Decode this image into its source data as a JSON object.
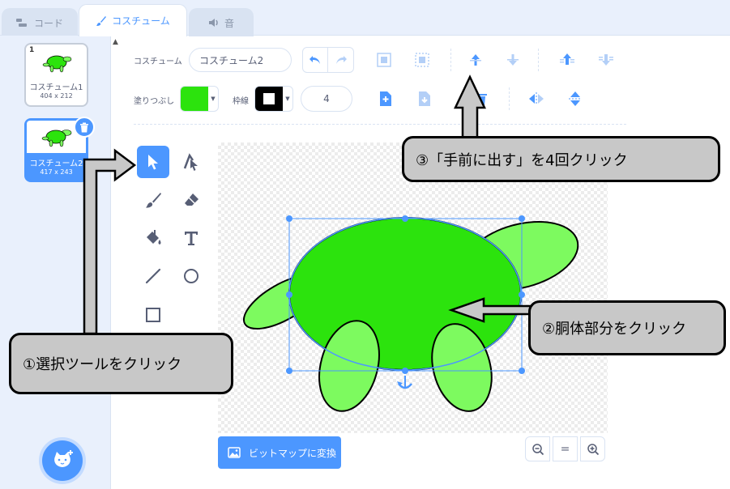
{
  "tabs": [
    {
      "label": "コード",
      "icon": "code-icon"
    },
    {
      "label": "コスチューム",
      "icon": "brush-icon"
    },
    {
      "label": "音",
      "icon": "speaker-icon"
    }
  ],
  "costumes": [
    {
      "number": "1",
      "name": "コスチューム1",
      "size": "404 x 212"
    },
    {
      "number": "2",
      "name": "コスチューム2",
      "size": "417 x 243"
    }
  ],
  "toolbar": {
    "costume_label": "コスチューム",
    "costume_name": "コスチューム2",
    "fill_label": "塗りつぶし",
    "fill_color": "#2ce30d",
    "outline_label": "枠線",
    "outline_color": "#000000",
    "outline_width": "4"
  },
  "tools": [
    "select-tool",
    "reshape-tool",
    "brush-tool",
    "eraser-tool",
    "fill-tool",
    "text-tool",
    "line-tool",
    "circle-tool",
    "rectangle-tool"
  ],
  "bitmap_button": "ビットマップに変換",
  "zoom": {
    "zoom_out": "−",
    "reset": "=",
    "zoom_in": "+"
  },
  "annotations": {
    "step1": "①選択ツールをクリック",
    "step2": "②胴体部分をクリック",
    "step3": "③「手前に出す」を4回クリック"
  },
  "colors": {
    "accent": "#4c97ff",
    "body_fill": "#2ce30d",
    "limb_fill": "#7dfa5f",
    "callout_bg": "#c8c8c8"
  }
}
